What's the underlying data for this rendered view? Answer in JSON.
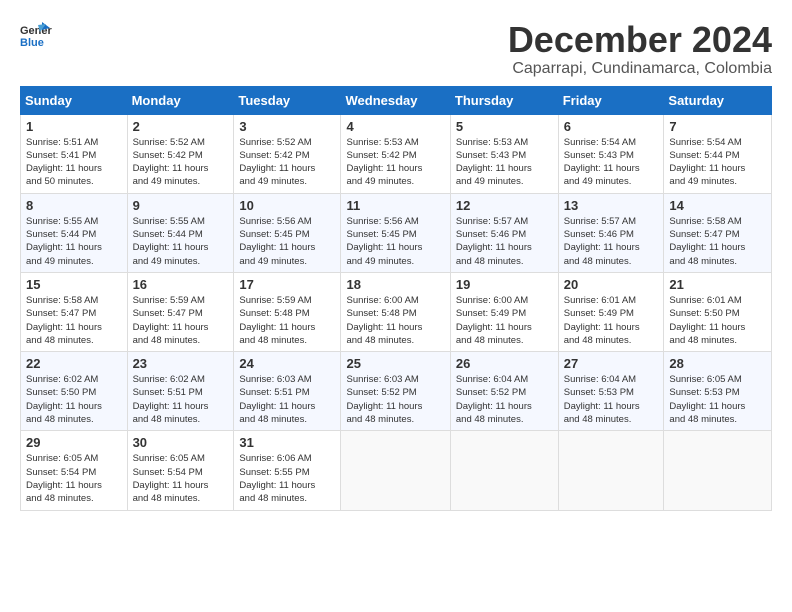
{
  "logo": {
    "general": "General",
    "blue": "Blue"
  },
  "title": "December 2024",
  "location": "Caparrapi, Cundinamarca, Colombia",
  "days_of_week": [
    "Sunday",
    "Monday",
    "Tuesday",
    "Wednesday",
    "Thursday",
    "Friday",
    "Saturday"
  ],
  "weeks": [
    [
      {
        "day": "1",
        "sunrise": "5:51 AM",
        "sunset": "5:41 PM",
        "daylight": "11 hours and 50 minutes."
      },
      {
        "day": "2",
        "sunrise": "5:52 AM",
        "sunset": "5:42 PM",
        "daylight": "11 hours and 49 minutes."
      },
      {
        "day": "3",
        "sunrise": "5:52 AM",
        "sunset": "5:42 PM",
        "daylight": "11 hours and 49 minutes."
      },
      {
        "day": "4",
        "sunrise": "5:53 AM",
        "sunset": "5:42 PM",
        "daylight": "11 hours and 49 minutes."
      },
      {
        "day": "5",
        "sunrise": "5:53 AM",
        "sunset": "5:43 PM",
        "daylight": "11 hours and 49 minutes."
      },
      {
        "day": "6",
        "sunrise": "5:54 AM",
        "sunset": "5:43 PM",
        "daylight": "11 hours and 49 minutes."
      },
      {
        "day": "7",
        "sunrise": "5:54 AM",
        "sunset": "5:44 PM",
        "daylight": "11 hours and 49 minutes."
      }
    ],
    [
      {
        "day": "8",
        "sunrise": "5:55 AM",
        "sunset": "5:44 PM",
        "daylight": "11 hours and 49 minutes."
      },
      {
        "day": "9",
        "sunrise": "5:55 AM",
        "sunset": "5:44 PM",
        "daylight": "11 hours and 49 minutes."
      },
      {
        "day": "10",
        "sunrise": "5:56 AM",
        "sunset": "5:45 PM",
        "daylight": "11 hours and 49 minutes."
      },
      {
        "day": "11",
        "sunrise": "5:56 AM",
        "sunset": "5:45 PM",
        "daylight": "11 hours and 49 minutes."
      },
      {
        "day": "12",
        "sunrise": "5:57 AM",
        "sunset": "5:46 PM",
        "daylight": "11 hours and 48 minutes."
      },
      {
        "day": "13",
        "sunrise": "5:57 AM",
        "sunset": "5:46 PM",
        "daylight": "11 hours and 48 minutes."
      },
      {
        "day": "14",
        "sunrise": "5:58 AM",
        "sunset": "5:47 PM",
        "daylight": "11 hours and 48 minutes."
      }
    ],
    [
      {
        "day": "15",
        "sunrise": "5:58 AM",
        "sunset": "5:47 PM",
        "daylight": "11 hours and 48 minutes."
      },
      {
        "day": "16",
        "sunrise": "5:59 AM",
        "sunset": "5:47 PM",
        "daylight": "11 hours and 48 minutes."
      },
      {
        "day": "17",
        "sunrise": "5:59 AM",
        "sunset": "5:48 PM",
        "daylight": "11 hours and 48 minutes."
      },
      {
        "day": "18",
        "sunrise": "6:00 AM",
        "sunset": "5:48 PM",
        "daylight": "11 hours and 48 minutes."
      },
      {
        "day": "19",
        "sunrise": "6:00 AM",
        "sunset": "5:49 PM",
        "daylight": "11 hours and 48 minutes."
      },
      {
        "day": "20",
        "sunrise": "6:01 AM",
        "sunset": "5:49 PM",
        "daylight": "11 hours and 48 minutes."
      },
      {
        "day": "21",
        "sunrise": "6:01 AM",
        "sunset": "5:50 PM",
        "daylight": "11 hours and 48 minutes."
      }
    ],
    [
      {
        "day": "22",
        "sunrise": "6:02 AM",
        "sunset": "5:50 PM",
        "daylight": "11 hours and 48 minutes."
      },
      {
        "day": "23",
        "sunrise": "6:02 AM",
        "sunset": "5:51 PM",
        "daylight": "11 hours and 48 minutes."
      },
      {
        "day": "24",
        "sunrise": "6:03 AM",
        "sunset": "5:51 PM",
        "daylight": "11 hours and 48 minutes."
      },
      {
        "day": "25",
        "sunrise": "6:03 AM",
        "sunset": "5:52 PM",
        "daylight": "11 hours and 48 minutes."
      },
      {
        "day": "26",
        "sunrise": "6:04 AM",
        "sunset": "5:52 PM",
        "daylight": "11 hours and 48 minutes."
      },
      {
        "day": "27",
        "sunrise": "6:04 AM",
        "sunset": "5:53 PM",
        "daylight": "11 hours and 48 minutes."
      },
      {
        "day": "28",
        "sunrise": "6:05 AM",
        "sunset": "5:53 PM",
        "daylight": "11 hours and 48 minutes."
      }
    ],
    [
      {
        "day": "29",
        "sunrise": "6:05 AM",
        "sunset": "5:54 PM",
        "daylight": "11 hours and 48 minutes."
      },
      {
        "day": "30",
        "sunrise": "6:05 AM",
        "sunset": "5:54 PM",
        "daylight": "11 hours and 48 minutes."
      },
      {
        "day": "31",
        "sunrise": "6:06 AM",
        "sunset": "5:55 PM",
        "daylight": "11 hours and 48 minutes."
      },
      null,
      null,
      null,
      null
    ]
  ]
}
